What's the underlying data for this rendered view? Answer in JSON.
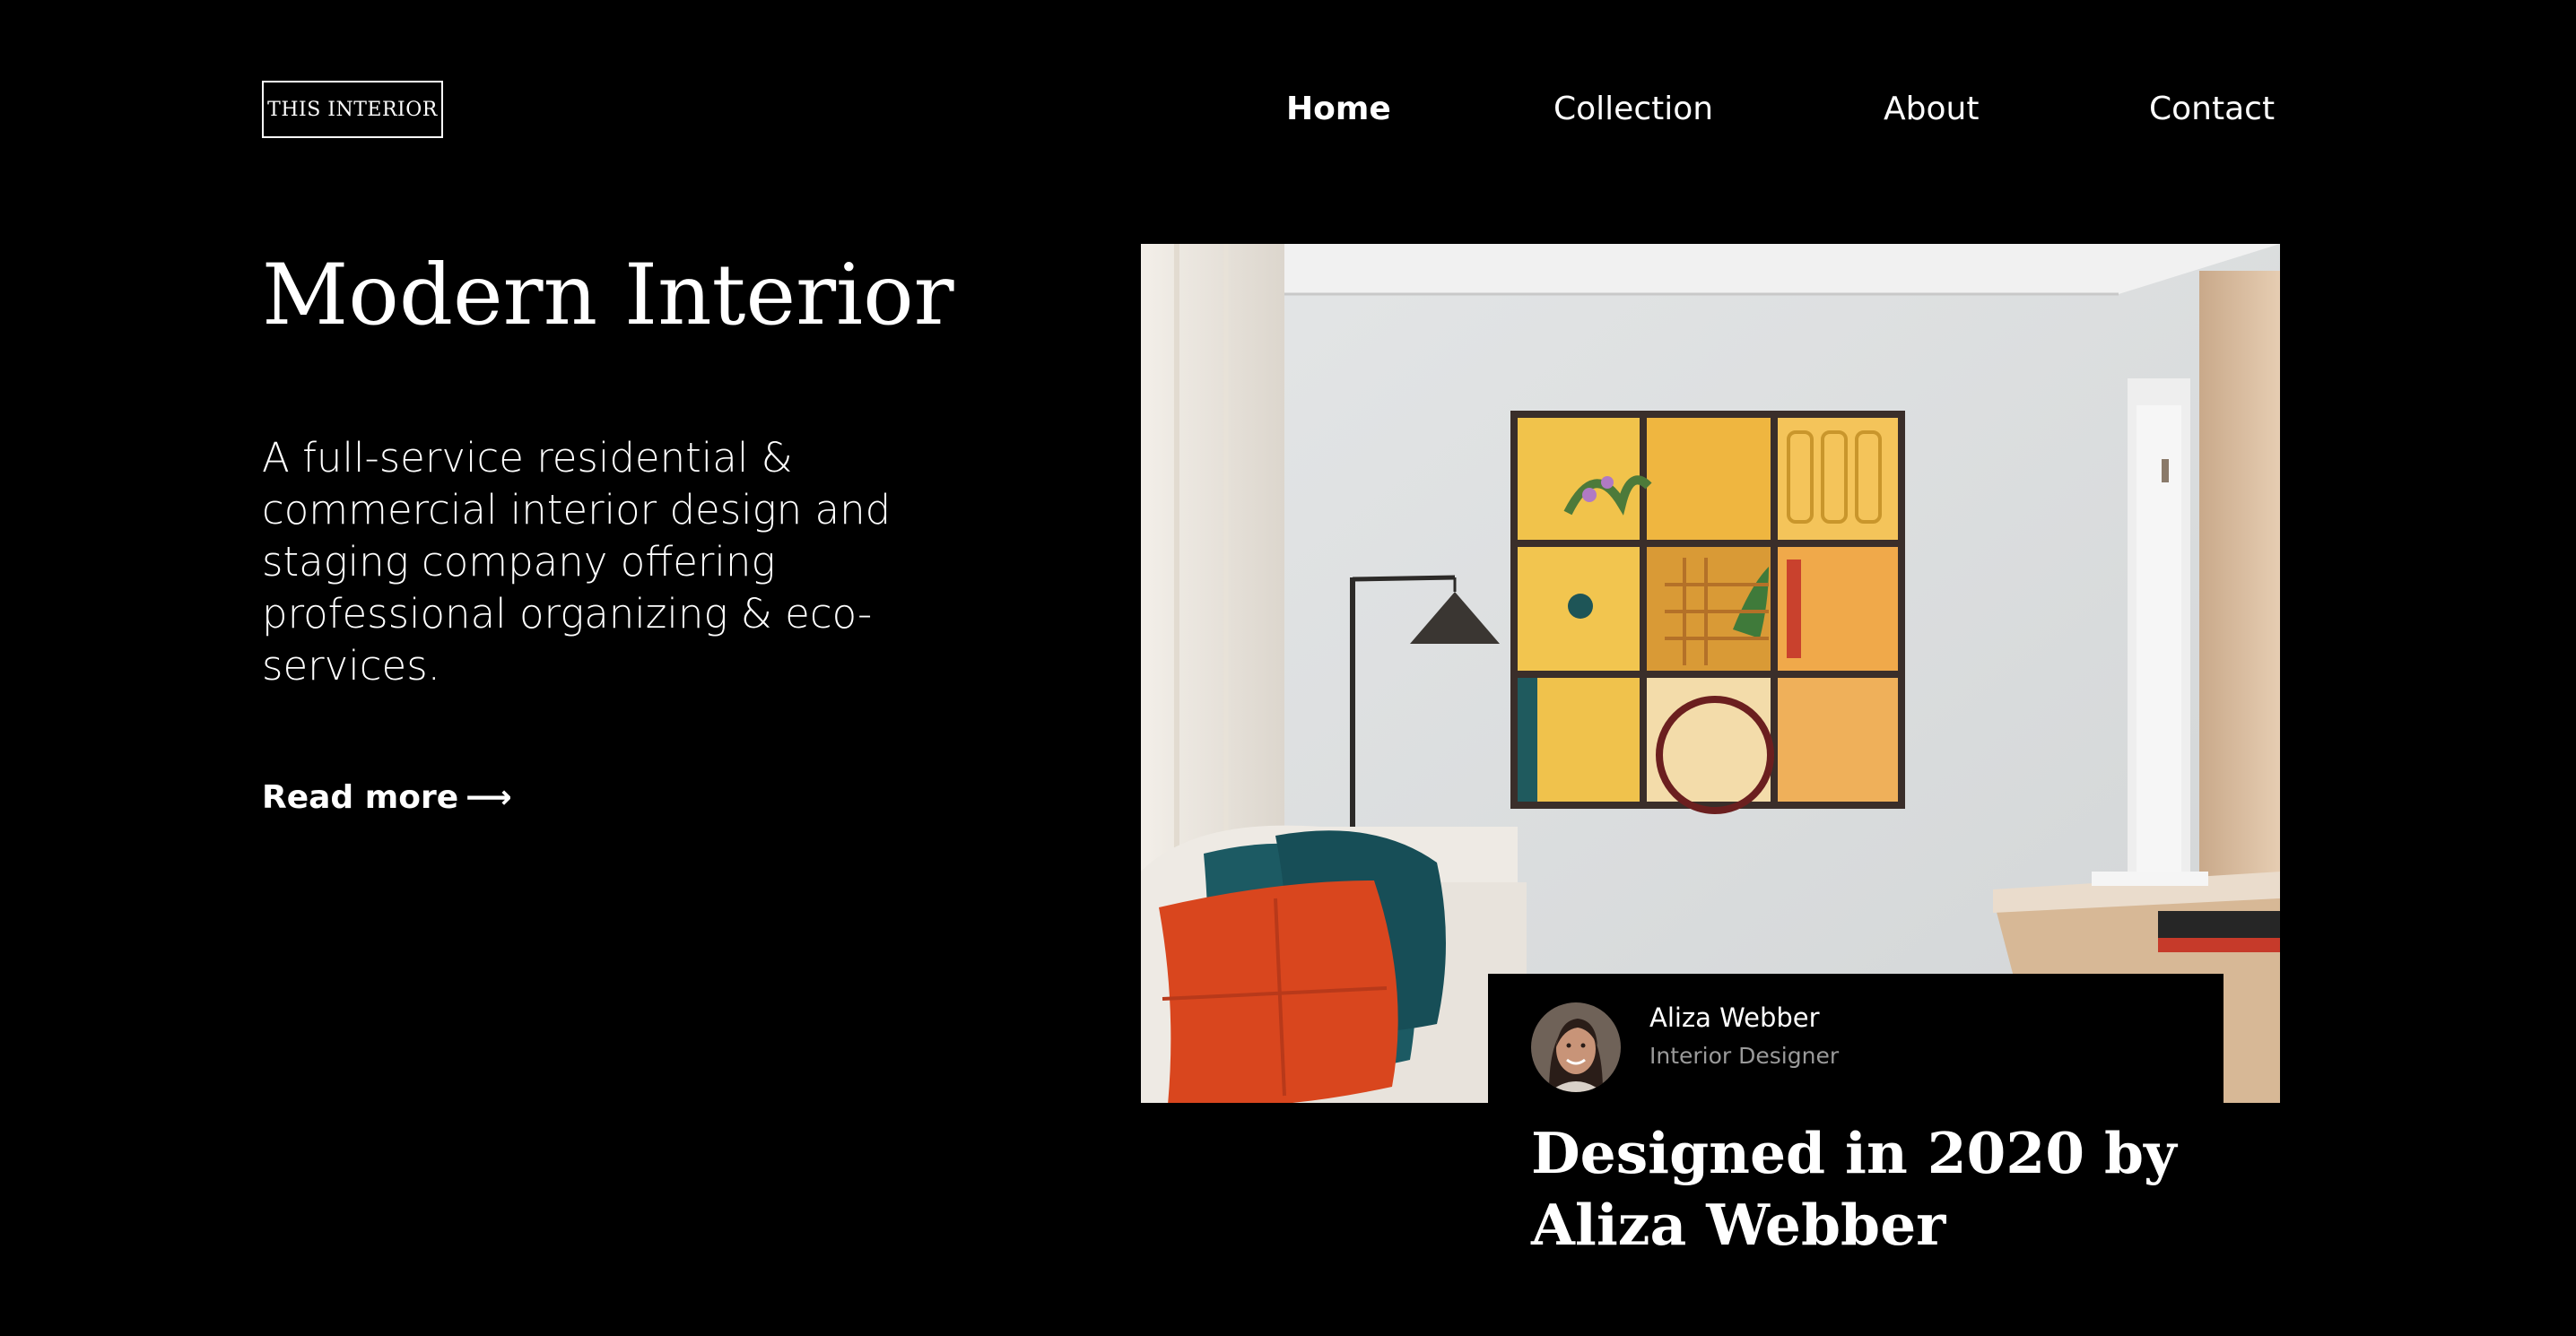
{
  "brand": {
    "logo_text": "THIS INTERIOR"
  },
  "nav": {
    "items": [
      {
        "label": "Home",
        "active": true
      },
      {
        "label": "Collection",
        "active": false
      },
      {
        "label": "About",
        "active": false
      },
      {
        "label": "Contact",
        "active": false
      }
    ]
  },
  "hero": {
    "title": "Modern Interior",
    "description": "A full-service residential & commercial interior design and staging company offering professional organizing & eco-services.",
    "read_more_label": "Read more",
    "read_more_icon": "arrow-right-icon"
  },
  "feature": {
    "image_subject": "living-room-photo",
    "designer": {
      "name": "Aliza Webber",
      "role": "Interior Designer"
    },
    "caption": "Designed in 2020 by Aliza Webber"
  },
  "colors": {
    "background": "#000000",
    "text": "#ffffff",
    "muted_text": "#9a9a9a"
  }
}
